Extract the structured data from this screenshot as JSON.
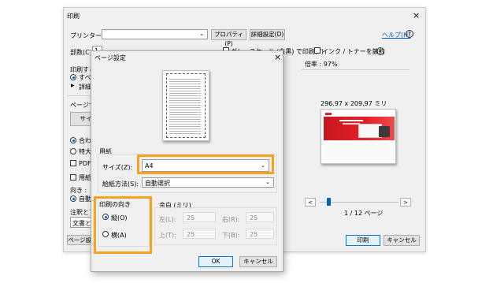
{
  "print_dialog": {
    "title": "印刷",
    "printer_label": "プリンター(N) :",
    "printer_value": "",
    "properties_button": "プロパティ(P)",
    "advanced_button": "詳細設定(D)",
    "help_link": "ヘルプ(H)",
    "copies_label": "部数(C) :",
    "copies_value": "1",
    "grayscale_label": "グレースケール (白黒) で印刷(Y)",
    "ink_save_label": "インク / トナーを節約",
    "pages_to_print_label": "印刷する",
    "all_option": "すべて",
    "more_options": "詳細オ",
    "page_size_label": "ページサイ",
    "size_button": "サイ",
    "fit_option": "合わせ",
    "actual_size_option": "特大ペ",
    "pdf_option": "PDF の",
    "paper_option": "用紙",
    "orientation_label": "向き :",
    "auto_option": "自動",
    "comments_label": "注釈とフォ",
    "comments_value": "文書と注",
    "page_setup_button": "ページ設定",
    "zoom_label": "倍率 : 97%",
    "preview_size": "296.97 x 209.97 ミリ",
    "page_indicator": "1 / 12 ページ",
    "nav_prev": "<",
    "nav_next": ">",
    "print_button": "印刷",
    "cancel_button": "キャンセル",
    "close": "×",
    "help_icon_glyph": "?",
    "info_icon_glyph": "i"
  },
  "page_setup": {
    "title": "ページ設定",
    "close": "×",
    "paper_group": "用紙",
    "size_label": "サイズ(Z):",
    "size_value": "A4",
    "source_label": "給紙方法(S):",
    "source_value": "自動選択",
    "orientation_group": "印刷の向き",
    "portrait_option": "縦(O)",
    "landscape_option": "横(A)",
    "margins_group": "余白 (ミリ)",
    "left_label": "左(L):",
    "left_value": "25",
    "right_label": "右(R):",
    "right_value": "25",
    "top_label": "上(T):",
    "top_value": "25",
    "bottom_label": "下(B):",
    "bottom_value": "25",
    "ok_button": "OK",
    "cancel_button": "キャンセル"
  },
  "colors": {
    "accent_orange": "#f7a21b",
    "link_blue": "#0055cc",
    "ok_border": "#0078d7",
    "preview_red": "#e3202a"
  }
}
